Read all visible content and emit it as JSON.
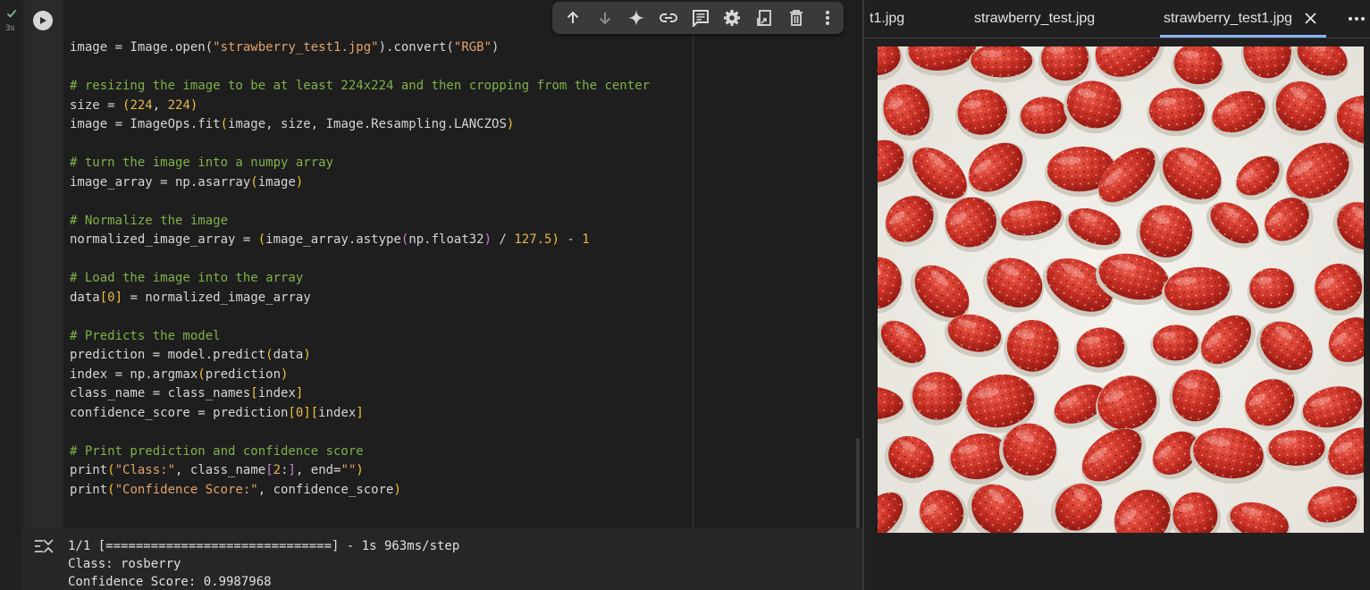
{
  "cell": {
    "exec_time": "3s",
    "code_lines": [
      [
        [
          "n",
          "image = Image.open("
        ],
        [
          "st",
          "\"strawberry_test1.jpg\""
        ],
        [
          "n",
          ").convert("
        ],
        [
          "st",
          "\"RGB\""
        ],
        [
          "n",
          ")"
        ]
      ],
      [],
      [
        [
          "cm",
          "# resizing the image to be at least 224x224 and then cropping from the center"
        ]
      ],
      [
        [
          "n",
          "size = "
        ],
        [
          "p1",
          "("
        ],
        [
          "nu",
          "224"
        ],
        [
          "n",
          ", "
        ],
        [
          "nu",
          "224"
        ],
        [
          "p1",
          ")"
        ]
      ],
      [
        [
          "n",
          "image = ImageOps.fit"
        ],
        [
          "p1",
          "("
        ],
        [
          "n",
          "image, size, Image.Resampling.LANCZOS"
        ],
        [
          "p1",
          ")"
        ]
      ],
      [],
      [
        [
          "cm",
          "# turn the image into a numpy array"
        ]
      ],
      [
        [
          "n",
          "image_array = np.asarray"
        ],
        [
          "p1",
          "("
        ],
        [
          "n",
          "image"
        ],
        [
          "p1",
          ")"
        ]
      ],
      [],
      [
        [
          "cm",
          "# Normalize the image"
        ]
      ],
      [
        [
          "n",
          "normalized_image_array = "
        ],
        [
          "p1",
          "("
        ],
        [
          "n",
          "image_array.astype"
        ],
        [
          "p2",
          "("
        ],
        [
          "n",
          "np.float32"
        ],
        [
          "p2",
          ")"
        ],
        [
          "n",
          " / "
        ],
        [
          "nu",
          "127.5"
        ],
        [
          "p1",
          ")"
        ],
        [
          "n",
          " - "
        ],
        [
          "nu",
          "1"
        ]
      ],
      [],
      [
        [
          "cm",
          "# Load the image into the array"
        ]
      ],
      [
        [
          "n",
          "data"
        ],
        [
          "p1",
          "["
        ],
        [
          "nu",
          "0"
        ],
        [
          "p1",
          "]"
        ],
        [
          "n",
          " = normalized_image_array"
        ]
      ],
      [],
      [
        [
          "cm",
          "# Predicts the model"
        ]
      ],
      [
        [
          "n",
          "prediction = model.predict"
        ],
        [
          "p1",
          "("
        ],
        [
          "n",
          "data"
        ],
        [
          "p1",
          ")"
        ]
      ],
      [
        [
          "n",
          "index = np.argmax"
        ],
        [
          "p1",
          "("
        ],
        [
          "n",
          "prediction"
        ],
        [
          "p1",
          ")"
        ]
      ],
      [
        [
          "n",
          "class_name = class_names"
        ],
        [
          "p1",
          "["
        ],
        [
          "n",
          "index"
        ],
        [
          "p1",
          "]"
        ]
      ],
      [
        [
          "n",
          "confidence_score = prediction"
        ],
        [
          "p1",
          "["
        ],
        [
          "nu",
          "0"
        ],
        [
          "p1",
          "]["
        ],
        [
          "n",
          "index"
        ],
        [
          "p1",
          "]"
        ]
      ],
      [],
      [
        [
          "cm",
          "# Print prediction and confidence score"
        ]
      ],
      [
        [
          "n",
          "print"
        ],
        [
          "p1",
          "("
        ],
        [
          "st",
          "\"Class:\""
        ],
        [
          "n",
          ", class_name"
        ],
        [
          "p2",
          "["
        ],
        [
          "nu",
          "2"
        ],
        [
          "n",
          ":"
        ],
        [
          "p2",
          "]"
        ],
        [
          "n",
          ", end="
        ],
        [
          "st",
          "\"\""
        ],
        [
          "p1",
          ")"
        ]
      ],
      [
        [
          "n",
          "print"
        ],
        [
          "p1",
          "("
        ],
        [
          "st",
          "\"Confidence Score:\""
        ],
        [
          "n",
          ", confidence_score"
        ],
        [
          "p1",
          ")"
        ]
      ]
    ]
  },
  "toolbar": {
    "buttons": [
      {
        "name": "move-cell-up-button",
        "icon": "arrow-up-icon"
      },
      {
        "name": "move-cell-down-button",
        "icon": "arrow-down-icon"
      },
      {
        "name": "gemini-button",
        "icon": "sparkle-icon"
      },
      {
        "name": "copy-link-button",
        "icon": "link-icon"
      },
      {
        "name": "add-comment-button",
        "icon": "comment-icon"
      },
      {
        "name": "cell-settings-button",
        "icon": "gear-icon"
      },
      {
        "name": "mirror-cell-button",
        "icon": "mirror-icon"
      },
      {
        "name": "delete-cell-button",
        "icon": "trash-icon"
      },
      {
        "name": "more-actions-button",
        "icon": "more-vert-icon"
      }
    ]
  },
  "output": {
    "lines": [
      "1/1 [==============================] - 1s 963ms/step",
      "Class: rosberry",
      "Confidence Score: 0.9987968"
    ]
  },
  "viewer": {
    "tabs": [
      {
        "label": "t1.jpg"
      },
      {
        "label": "strawberry_test.jpg"
      },
      {
        "label": "strawberry_test1.jpg",
        "active": true
      }
    ]
  },
  "colors": {
    "accent": "#8ab4f8",
    "success": "#81c995",
    "comment": "#7fb14a",
    "string": "#e2a26c",
    "number": "#e5b64f"
  }
}
